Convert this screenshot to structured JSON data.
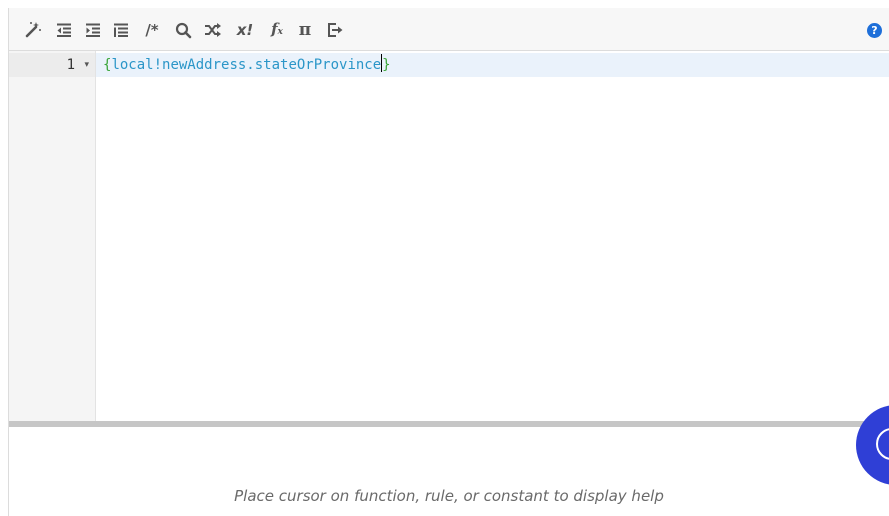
{
  "toolbar": {
    "buttons": [
      {
        "name": "pretty-print-button",
        "icon": "magic-wand-icon"
      },
      {
        "name": "outdent-button",
        "icon": "outdent-icon"
      },
      {
        "name": "indent-button",
        "icon": "indent-icon"
      },
      {
        "name": "list-button",
        "icon": "list-icon"
      },
      {
        "name": "comment-button",
        "icon": "comment-icon",
        "label": "/*"
      },
      {
        "name": "search-button",
        "icon": "search-icon"
      },
      {
        "name": "shuffle-button",
        "icon": "shuffle-icon"
      },
      {
        "name": "variable-button",
        "icon": "variable-icon",
        "label": "x!"
      },
      {
        "name": "function-button",
        "icon": "function-icon"
      },
      {
        "name": "constant-button",
        "icon": "pi-icon",
        "label": "π"
      },
      {
        "name": "export-button",
        "icon": "export-icon"
      }
    ],
    "help_label": "?"
  },
  "editor": {
    "line_number": "1",
    "fold_symbol": "▾",
    "code": {
      "open_brace": "{",
      "expression": "local!newAddress.stateOrProvince",
      "close_brace": "}"
    }
  },
  "help_panel": {
    "text": "Place cursor on function, rule, or constant to display help"
  },
  "colors": {
    "identifier": "#2b96c8",
    "brace": "#3aa53a",
    "fab": "#2f3fd6",
    "help_icon": "#1e6fd9"
  }
}
